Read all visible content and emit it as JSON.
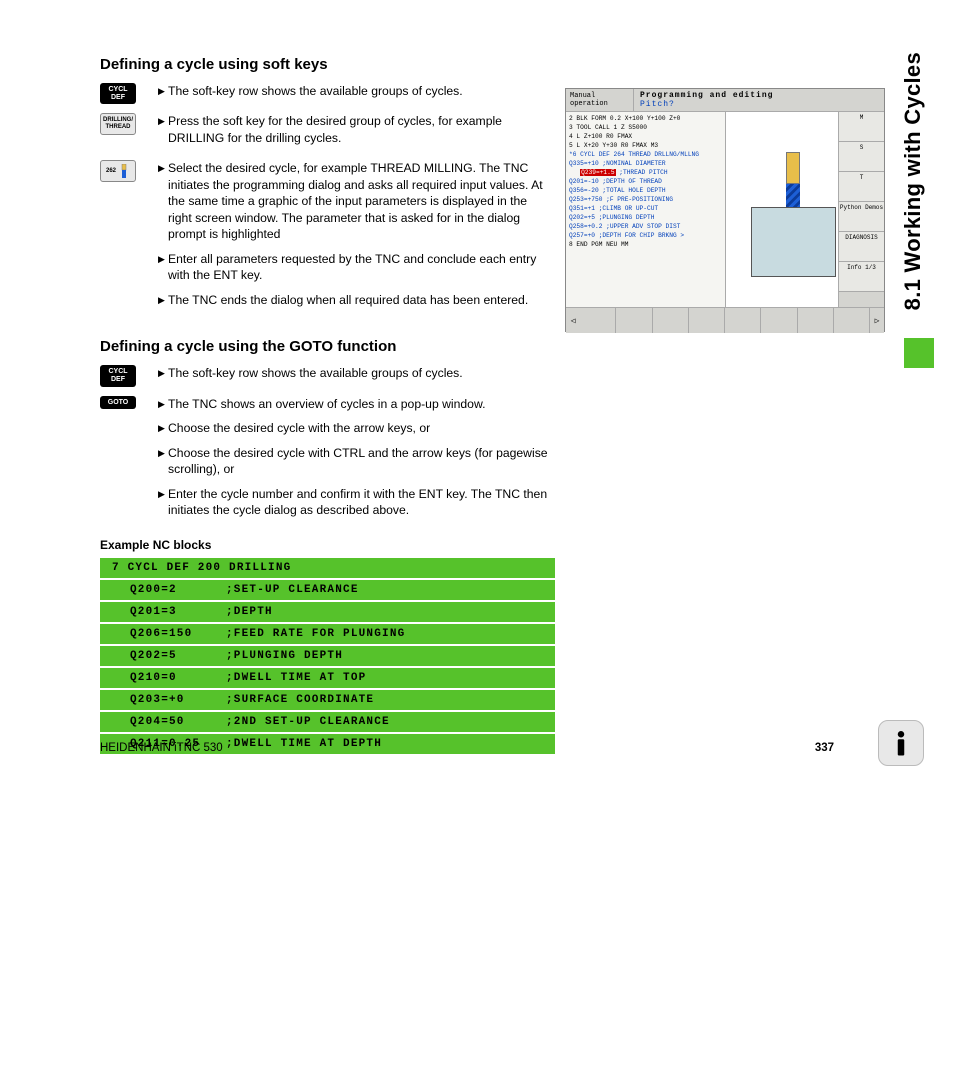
{
  "sideTitle": "8.1 Working with Cycles",
  "section1": {
    "heading": "Defining a cycle using soft keys",
    "keys": {
      "k1": "CYCL DEF",
      "k2": "DRILLING/ THREAD",
      "k3": "262"
    },
    "items": [
      "The soft-key row shows the available groups of cycles.",
      "Press the soft key for the desired group of cycles, for example DRILLING for the drilling cycles.",
      "Select the desired cycle, for example THREAD MILLING. The TNC initiates the programming dialog and asks all required input values. At the same time a graphic of the input parameters is displayed in the right screen window. The parameter that is asked for in the dialog prompt is highlighted",
      "Enter all parameters requested by the TNC and conclude each entry with the ENT key.",
      "The TNC ends the dialog when all required data has been entered."
    ]
  },
  "section2": {
    "heading": "Defining a cycle using the GOTO function",
    "keys": {
      "k1": "CYCL DEF",
      "k2": "GOTO"
    },
    "items": [
      "The soft-key row shows the available groups of cycles.",
      "The TNC shows an overview of cycles in a pop-up window.",
      "Choose the desired cycle with the arrow keys, or",
      "Choose the desired cycle with CTRL and the arrow keys (for pagewise scrolling), or",
      "Enter the cycle number and confirm it with the ENT key. The TNC then initiates the cycle dialog as described above."
    ]
  },
  "ncHeading": "Example NC blocks",
  "nc": {
    "header": "7 CYCL DEF 200 DRILLING",
    "rows": [
      {
        "p": "Q200=2",
        "c": ";SET-UP CLEARANCE"
      },
      {
        "p": "Q201=3",
        "c": ";DEPTH"
      },
      {
        "p": "Q206=150",
        "c": ";FEED RATE FOR PLUNGING"
      },
      {
        "p": "Q202=5",
        "c": ";PLUNGING DEPTH"
      },
      {
        "p": "Q210=0",
        "c": ";DWELL TIME AT TOP"
      },
      {
        "p": "Q203=+0",
        "c": ";SURFACE COORDINATE"
      },
      {
        "p": "Q204=50",
        "c": ";2ND SET-UP CLEARANCE"
      },
      {
        "p": "Q211=0.25",
        "c": ";DWELL TIME AT DEPTH"
      }
    ]
  },
  "screenshot": {
    "mode": "Manual operation",
    "title": "Programming and editing",
    "prompt": "Pitch?",
    "code": [
      {
        "t": "2  BLK FORM 0.2  X+100  Y+100  Z+0",
        "blue": false
      },
      {
        "t": "3  TOOL CALL 1 Z S5000",
        "blue": false
      },
      {
        "t": "4  L  Z+100 R0 FMAX",
        "blue": false
      },
      {
        "t": "5  L  X+20  Y+30 R0 FMAX M3",
        "blue": false
      },
      {
        "t": "*6  CYCL DEF 264 THREAD DRLLNG/MLLNG",
        "blue": true
      },
      {
        "t": "   Q335=+10   ;NOMINAL DIAMETER",
        "blue": true
      },
      {
        "t": "   Q239=+1.5  ;THREAD PITCH",
        "blue": true,
        "hl": true
      },
      {
        "t": "   Q201=-10   ;DEPTH OF THREAD",
        "blue": true
      },
      {
        "t": "   Q356=-20   ;TOTAL HOLE DEPTH",
        "blue": true
      },
      {
        "t": "   Q253=+750  ;F PRE-POSITIONING",
        "blue": true
      },
      {
        "t": "   Q351=+1    ;CLIMB OR UP-CUT",
        "blue": true
      },
      {
        "t": "   Q202=+5    ;PLUNGING DEPTH",
        "blue": true
      },
      {
        "t": "   Q258=+0.2  ;UPPER ADV STOP DIST",
        "blue": true
      },
      {
        "t": "   Q257=+0    ;DEPTH FOR CHIP BRKNG  >",
        "blue": true
      },
      {
        "t": "8  END PGM NEU MM",
        "blue": false
      }
    ],
    "rightButtons": [
      "M",
      "S",
      "T",
      "Python Demos",
      "DIAGNOSIS",
      "Info 1/3"
    ]
  },
  "footer": {
    "left": "HEIDENHAIN iTNC 530",
    "page": "337"
  }
}
